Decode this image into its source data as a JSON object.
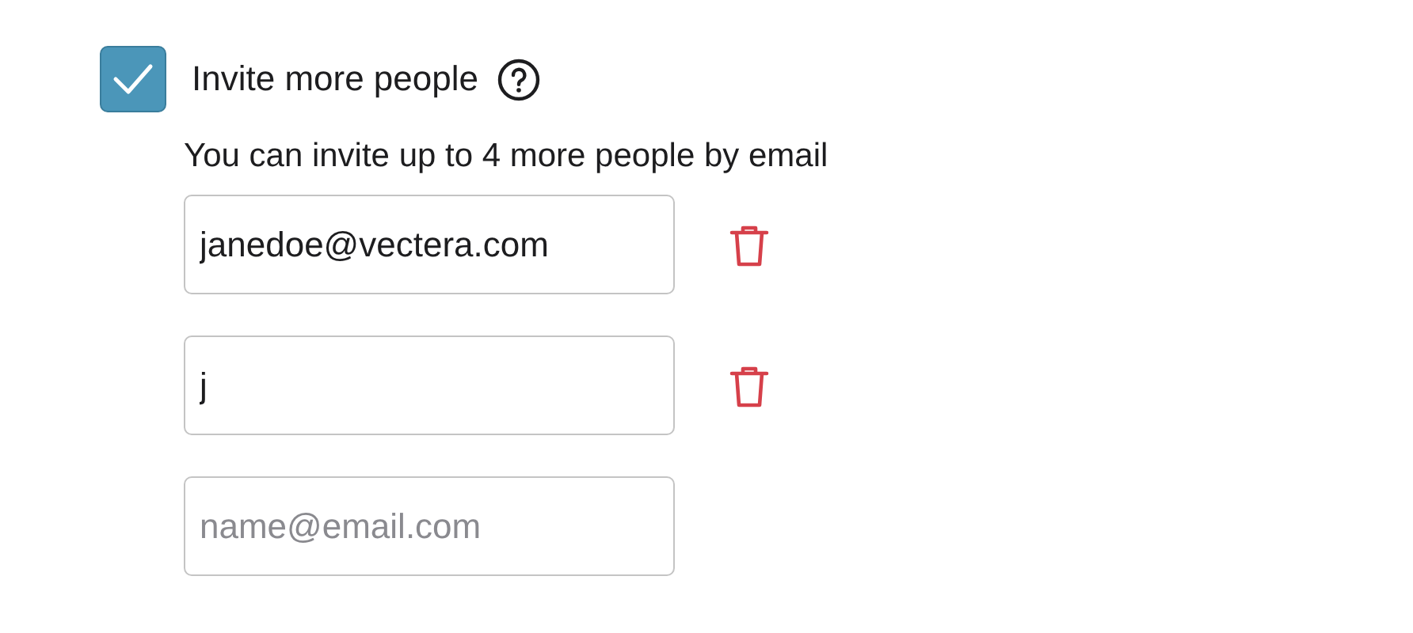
{
  "invite": {
    "checked": true,
    "label": "Invite more people",
    "description": "You can invite up to 4 more people by email",
    "emails": [
      {
        "value": "janedoe@vectera.com",
        "removable": true
      },
      {
        "value": "j",
        "removable": true
      },
      {
        "placeholder": "name@email.com",
        "removable": false
      }
    ]
  }
}
